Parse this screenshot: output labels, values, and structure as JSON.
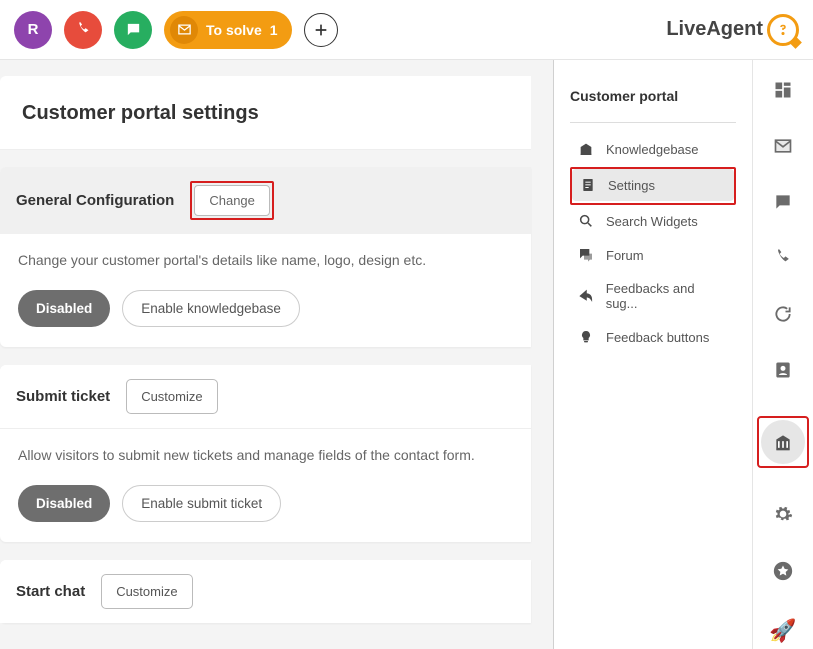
{
  "header": {
    "brand": "LiveAgent",
    "pill_label": "To solve",
    "pill_count": "1",
    "avatar_initial": "R"
  },
  "subnav": {
    "title": "Customer portal",
    "items": [
      {
        "label": "Knowledgebase"
      },
      {
        "label": "Settings"
      },
      {
        "label": "Search Widgets"
      },
      {
        "label": "Forum"
      },
      {
        "label": "Feedbacks and sug..."
      },
      {
        "label": "Feedback buttons"
      }
    ]
  },
  "page": {
    "title": "Customer portal settings",
    "sections": {
      "general": {
        "heading": "General Configuration",
        "change_btn": "Change",
        "desc": "Change your customer portal's details like name, logo, design etc.",
        "disabled_btn": "Disabled",
        "enable_btn": "Enable knowledgebase"
      },
      "submit_ticket": {
        "heading": "Submit ticket",
        "customize_btn": "Customize",
        "desc": "Allow visitors to submit new tickets and manage fields of the contact form.",
        "disabled_btn": "Disabled",
        "enable_btn": "Enable submit ticket"
      },
      "start_chat": {
        "heading": "Start chat",
        "customize_btn": "Customize"
      }
    }
  }
}
